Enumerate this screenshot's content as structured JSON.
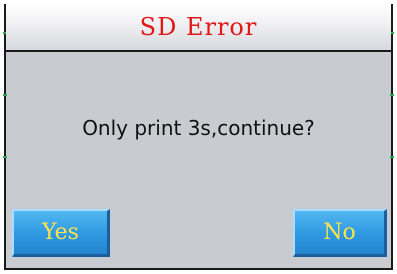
{
  "dialog": {
    "title": "SD Error",
    "message": "Only print 3s,continue?",
    "yes_label": "Yes",
    "no_label": "No"
  },
  "colors": {
    "title_text": "#e01818",
    "button_fill": "#2e98e0",
    "button_text": "#ffe34a",
    "panel_background": "#c8cbd0"
  }
}
